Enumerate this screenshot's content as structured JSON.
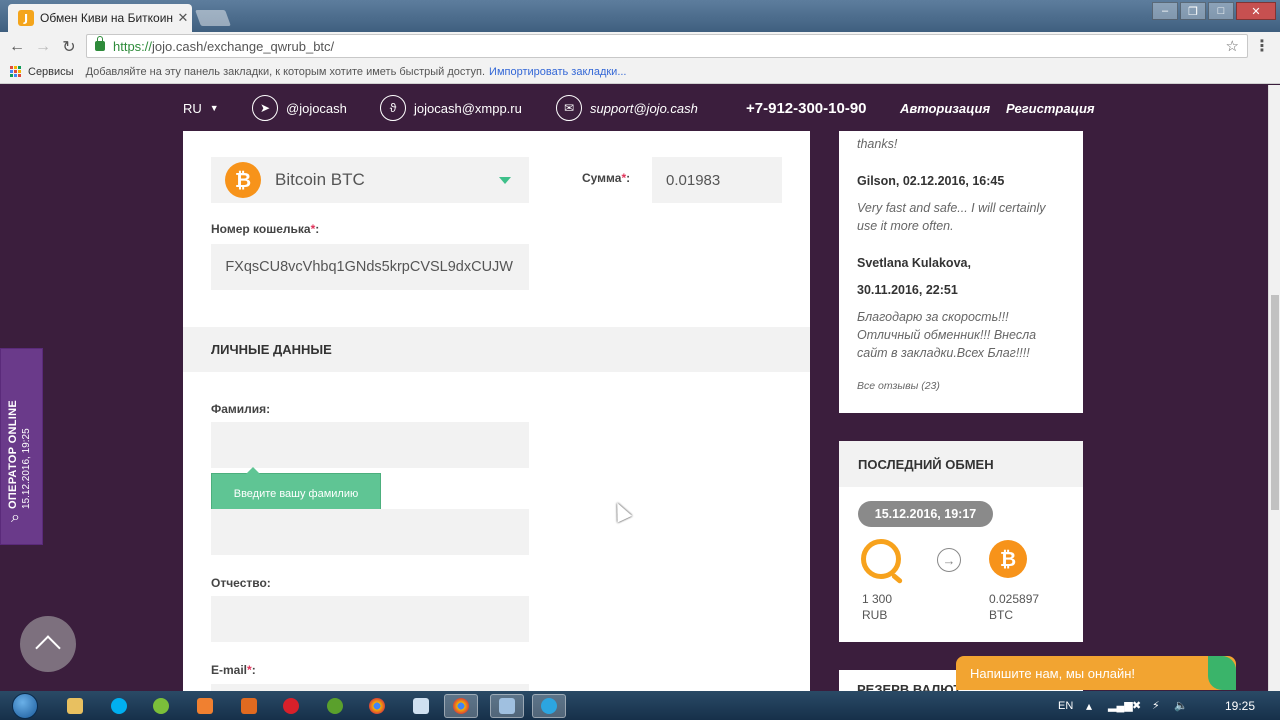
{
  "browser": {
    "tab_title": "Обмен Киви на Биткоин",
    "tab_favicon": "J",
    "url_secure": "https://",
    "url_rest": "jojo.cash/exchange_qwrub_btc/",
    "bookmarks_apps": "Сервисы",
    "bookmarks_hint": "Добавляйте на эту панель закладки, к которым хотите иметь быстрый доступ.",
    "bookmarks_import": "Импортировать закладки..."
  },
  "nav": {
    "lang": "RU",
    "telegram": "@jojocash",
    "xmpp": "jojocash@xmpp.ru",
    "email": "support@jojo.cash",
    "phone": "+7-912-300-10-90",
    "login": "Авторизация",
    "register": "Регистрация"
  },
  "form": {
    "currency": "Bitcoin BTC",
    "amount_label": "Сумма",
    "amount_value": "0.01983",
    "wallet_label": "Номер кошелька",
    "wallet_value": "FXqsCU8vcVhbq1GNds5krpCVSL9dxCUJW",
    "section_title": "ЛИЧНЫЕ ДАННЫЕ",
    "lastname_label": "Фамилия:",
    "tooltip": "Введите вашу фамилию",
    "middlename_label": "Отчество:",
    "email_label": "E-mail"
  },
  "reviews": {
    "first_text": "thanks!",
    "items": [
      {
        "author": "Gilson, 02.12.2016, 16:45",
        "text": "Very fast and safe... I will certainly use it more often."
      },
      {
        "author": "Svetlana Kulakova,",
        "author2": "30.11.2016, 22:51",
        "text": "Благодарю за скорость!!! Отличный обменник!!! Внесла сайт в закладки.Всех Благ!!!!"
      }
    ],
    "all_link": "Все отзывы (23)"
  },
  "last_exchange": {
    "title": "ПОСЛЕДНИЙ ОБМЕН",
    "date": "15.12.2016, 19:17",
    "from_amount": "1 300",
    "from_cur": "RUB",
    "to_amount": "0.025897",
    "to_cur": "BTC"
  },
  "reserve_title": "РЕЗЕРВ ВАЛЮТ",
  "operator": {
    "title": "ОПЕРАТОР ONLINE",
    "date": "15.12.2016, 19:25"
  },
  "chat": "Напишите нам, мы онлайн!",
  "taskbar": {
    "lang": "EN",
    "time": "19:25"
  },
  "colors": {
    "page_bg": "#3b1e3d",
    "bitcoin": "#f7931a",
    "accent_green": "#5fc594",
    "chat_orange": "#f2a431",
    "required": "#e0345a"
  }
}
